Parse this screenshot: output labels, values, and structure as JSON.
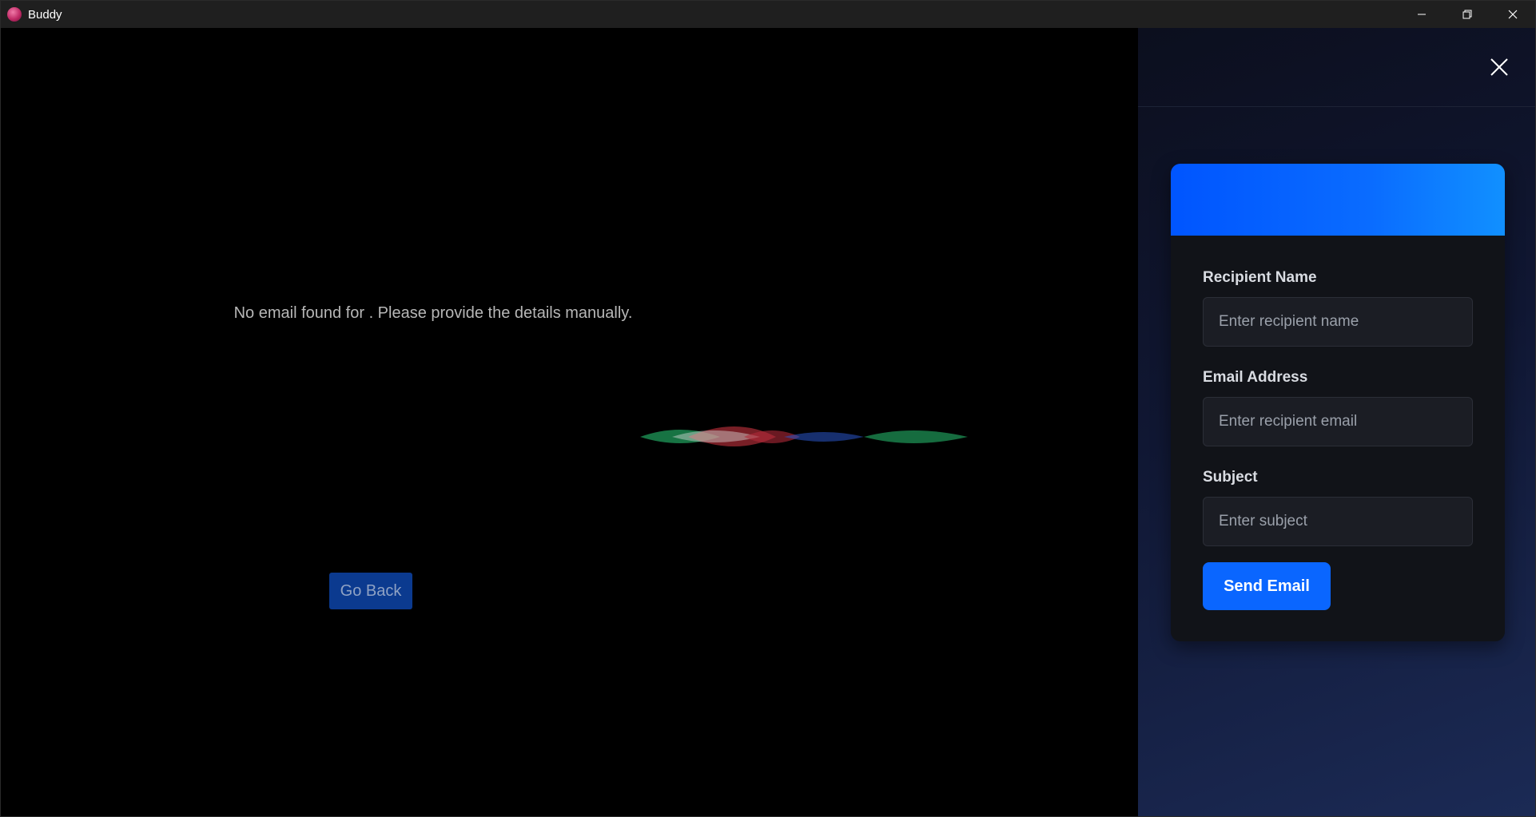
{
  "window": {
    "title": "Buddy",
    "icon": "buddy-app-icon"
  },
  "stage": {
    "message": "No email found for . Please provide the details manually.",
    "go_back_label": "Go Back",
    "wave_colors": [
      "#1f9a5a",
      "#c8343f",
      "#2a55c8",
      "#e0e0e0"
    ]
  },
  "email_form": {
    "accent": "#0a66ff",
    "recipient_name": {
      "label": "Recipient Name",
      "placeholder": "Enter recipient name",
      "value": ""
    },
    "email_address": {
      "label": "Email Address",
      "placeholder": "Enter recipient email",
      "value": ""
    },
    "subject": {
      "label": "Subject",
      "placeholder": "Enter subject",
      "value": ""
    },
    "send_label": "Send Email"
  }
}
